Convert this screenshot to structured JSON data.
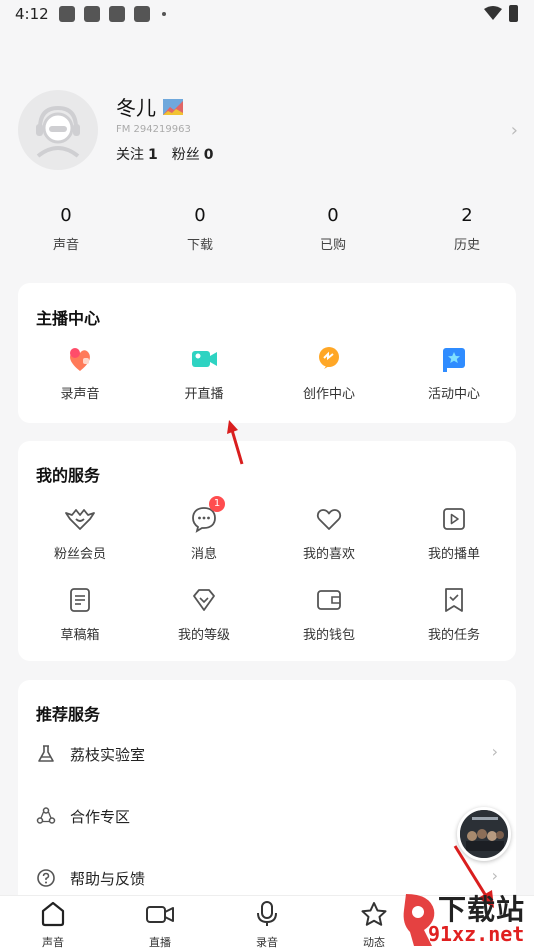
{
  "status_bar": {
    "time": "4:12"
  },
  "profile": {
    "username": "冬儿",
    "fm_id": "FM 294219963",
    "following_label": "关注",
    "following_count": "1",
    "fans_label": "粉丝",
    "fans_count": "0"
  },
  "stats": [
    {
      "value": "0",
      "label": "声音"
    },
    {
      "value": "0",
      "label": "下载"
    },
    {
      "value": "0",
      "label": "已购"
    },
    {
      "value": "2",
      "label": "历史"
    }
  ],
  "anchor_center": {
    "title": "主播中心",
    "items": [
      {
        "label": "录声音",
        "icon": "record-voice-icon"
      },
      {
        "label": "开直播",
        "icon": "live-camera-icon"
      },
      {
        "label": "创作中心",
        "icon": "creation-bulb-icon"
      },
      {
        "label": "活动中心",
        "icon": "activity-flag-icon"
      }
    ]
  },
  "my_services": {
    "title": "我的服务",
    "items": [
      {
        "label": "粉丝会员",
        "icon": "fan-membership-icon"
      },
      {
        "label": "消息",
        "icon": "message-icon",
        "badge": "1"
      },
      {
        "label": "我的喜欢",
        "icon": "heart-icon"
      },
      {
        "label": "我的播单",
        "icon": "playlist-icon"
      },
      {
        "label": "草稿箱",
        "icon": "drafts-icon"
      },
      {
        "label": "我的等级",
        "icon": "level-diamond-icon"
      },
      {
        "label": "我的钱包",
        "icon": "wallet-icon"
      },
      {
        "label": "我的任务",
        "icon": "task-icon"
      }
    ]
  },
  "recommended": {
    "title": "推荐服务",
    "items": [
      {
        "label": "荔枝实验室",
        "icon": "flask-icon"
      },
      {
        "label": "合作专区",
        "icon": "cooperation-icon"
      },
      {
        "label": "帮助与反馈",
        "icon": "help-icon"
      }
    ]
  },
  "tabs": [
    {
      "label": "声音",
      "icon": "home-icon"
    },
    {
      "label": "直播",
      "icon": "video-camera-icon"
    },
    {
      "label": "录音",
      "icon": "microphone-icon"
    },
    {
      "label": "动态",
      "icon": "star-icon"
    }
  ],
  "watermark": {
    "line1": "下载站",
    "line2": "91xz.net"
  },
  "colors": {
    "accent_red": "#ff4d4f",
    "arrow_red": "#d91e1e"
  }
}
